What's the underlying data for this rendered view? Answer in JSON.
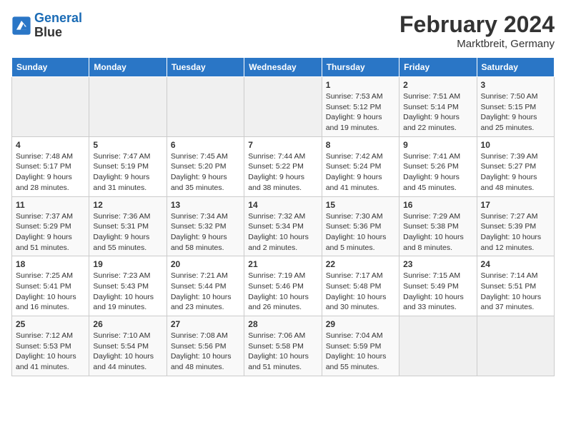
{
  "header": {
    "logo_line1": "General",
    "logo_line2": "Blue",
    "month_year": "February 2024",
    "location": "Marktbreit, Germany"
  },
  "days_of_week": [
    "Sunday",
    "Monday",
    "Tuesday",
    "Wednesday",
    "Thursday",
    "Friday",
    "Saturday"
  ],
  "weeks": [
    [
      {
        "day": "",
        "info": ""
      },
      {
        "day": "",
        "info": ""
      },
      {
        "day": "",
        "info": ""
      },
      {
        "day": "",
        "info": ""
      },
      {
        "day": "1",
        "info": "Sunrise: 7:53 AM\nSunset: 5:12 PM\nDaylight: 9 hours\nand 19 minutes."
      },
      {
        "day": "2",
        "info": "Sunrise: 7:51 AM\nSunset: 5:14 PM\nDaylight: 9 hours\nand 22 minutes."
      },
      {
        "day": "3",
        "info": "Sunrise: 7:50 AM\nSunset: 5:15 PM\nDaylight: 9 hours\nand 25 minutes."
      }
    ],
    [
      {
        "day": "4",
        "info": "Sunrise: 7:48 AM\nSunset: 5:17 PM\nDaylight: 9 hours\nand 28 minutes."
      },
      {
        "day": "5",
        "info": "Sunrise: 7:47 AM\nSunset: 5:19 PM\nDaylight: 9 hours\nand 31 minutes."
      },
      {
        "day": "6",
        "info": "Sunrise: 7:45 AM\nSunset: 5:20 PM\nDaylight: 9 hours\nand 35 minutes."
      },
      {
        "day": "7",
        "info": "Sunrise: 7:44 AM\nSunset: 5:22 PM\nDaylight: 9 hours\nand 38 minutes."
      },
      {
        "day": "8",
        "info": "Sunrise: 7:42 AM\nSunset: 5:24 PM\nDaylight: 9 hours\nand 41 minutes."
      },
      {
        "day": "9",
        "info": "Sunrise: 7:41 AM\nSunset: 5:26 PM\nDaylight: 9 hours\nand 45 minutes."
      },
      {
        "day": "10",
        "info": "Sunrise: 7:39 AM\nSunset: 5:27 PM\nDaylight: 9 hours\nand 48 minutes."
      }
    ],
    [
      {
        "day": "11",
        "info": "Sunrise: 7:37 AM\nSunset: 5:29 PM\nDaylight: 9 hours\nand 51 minutes."
      },
      {
        "day": "12",
        "info": "Sunrise: 7:36 AM\nSunset: 5:31 PM\nDaylight: 9 hours\nand 55 minutes."
      },
      {
        "day": "13",
        "info": "Sunrise: 7:34 AM\nSunset: 5:32 PM\nDaylight: 9 hours\nand 58 minutes."
      },
      {
        "day": "14",
        "info": "Sunrise: 7:32 AM\nSunset: 5:34 PM\nDaylight: 10 hours\nand 2 minutes."
      },
      {
        "day": "15",
        "info": "Sunrise: 7:30 AM\nSunset: 5:36 PM\nDaylight: 10 hours\nand 5 minutes."
      },
      {
        "day": "16",
        "info": "Sunrise: 7:29 AM\nSunset: 5:38 PM\nDaylight: 10 hours\nand 8 minutes."
      },
      {
        "day": "17",
        "info": "Sunrise: 7:27 AM\nSunset: 5:39 PM\nDaylight: 10 hours\nand 12 minutes."
      }
    ],
    [
      {
        "day": "18",
        "info": "Sunrise: 7:25 AM\nSunset: 5:41 PM\nDaylight: 10 hours\nand 16 minutes."
      },
      {
        "day": "19",
        "info": "Sunrise: 7:23 AM\nSunset: 5:43 PM\nDaylight: 10 hours\nand 19 minutes."
      },
      {
        "day": "20",
        "info": "Sunrise: 7:21 AM\nSunset: 5:44 PM\nDaylight: 10 hours\nand 23 minutes."
      },
      {
        "day": "21",
        "info": "Sunrise: 7:19 AM\nSunset: 5:46 PM\nDaylight: 10 hours\nand 26 minutes."
      },
      {
        "day": "22",
        "info": "Sunrise: 7:17 AM\nSunset: 5:48 PM\nDaylight: 10 hours\nand 30 minutes."
      },
      {
        "day": "23",
        "info": "Sunrise: 7:15 AM\nSunset: 5:49 PM\nDaylight: 10 hours\nand 33 minutes."
      },
      {
        "day": "24",
        "info": "Sunrise: 7:14 AM\nSunset: 5:51 PM\nDaylight: 10 hours\nand 37 minutes."
      }
    ],
    [
      {
        "day": "25",
        "info": "Sunrise: 7:12 AM\nSunset: 5:53 PM\nDaylight: 10 hours\nand 41 minutes."
      },
      {
        "day": "26",
        "info": "Sunrise: 7:10 AM\nSunset: 5:54 PM\nDaylight: 10 hours\nand 44 minutes."
      },
      {
        "day": "27",
        "info": "Sunrise: 7:08 AM\nSunset: 5:56 PM\nDaylight: 10 hours\nand 48 minutes."
      },
      {
        "day": "28",
        "info": "Sunrise: 7:06 AM\nSunset: 5:58 PM\nDaylight: 10 hours\nand 51 minutes."
      },
      {
        "day": "29",
        "info": "Sunrise: 7:04 AM\nSunset: 5:59 PM\nDaylight: 10 hours\nand 55 minutes."
      },
      {
        "day": "",
        "info": ""
      },
      {
        "day": "",
        "info": ""
      }
    ]
  ]
}
